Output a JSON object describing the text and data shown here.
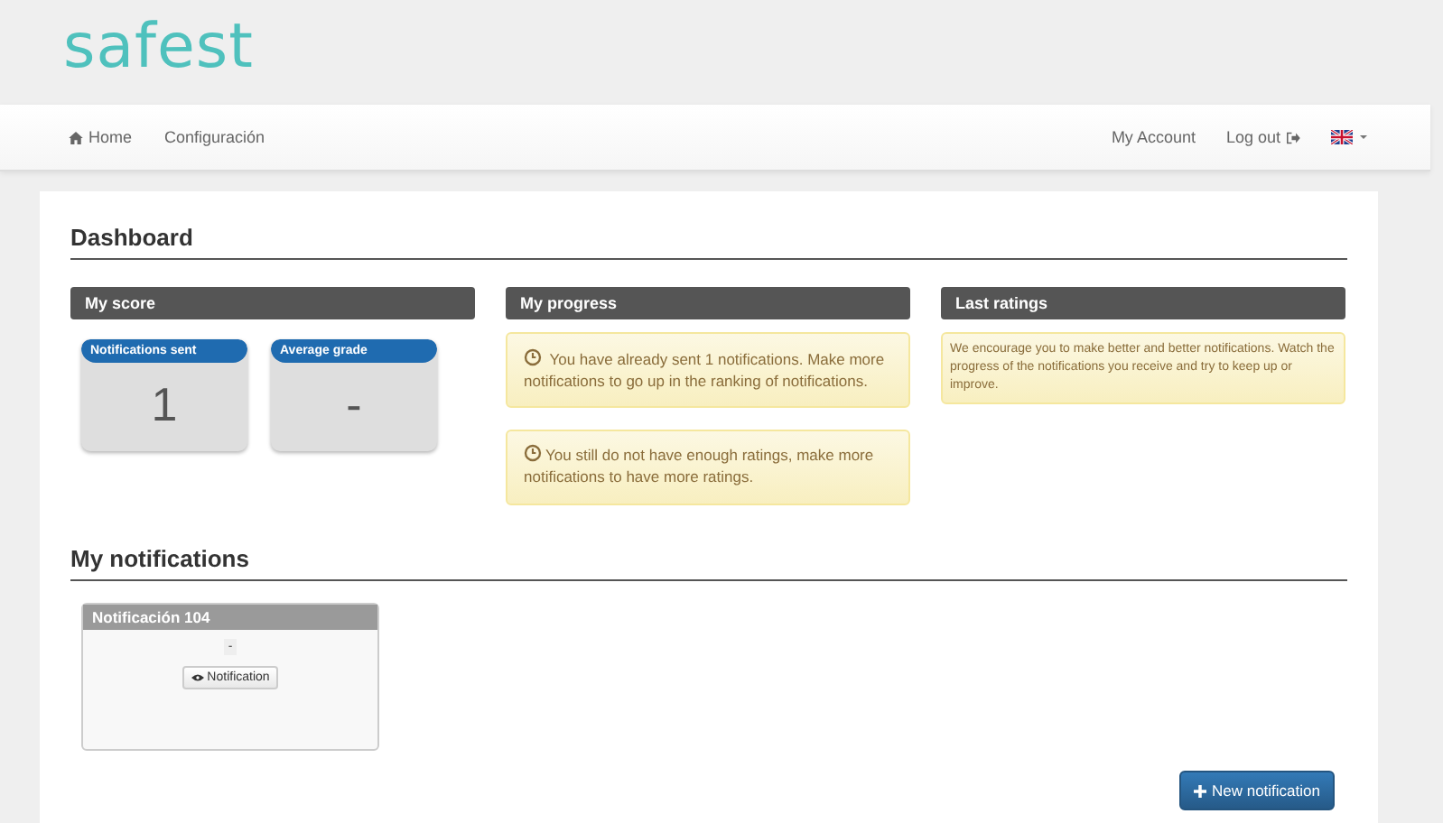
{
  "logo": "safest",
  "nav": {
    "left": [
      {
        "label": "Home"
      },
      {
        "label": "Configuración"
      }
    ],
    "right": [
      {
        "label": "My Account"
      },
      {
        "label": "Log out"
      }
    ]
  },
  "dashboard": {
    "title": "Dashboard",
    "score": {
      "title": "My score",
      "cards": [
        {
          "label": "Notifications sent",
          "value": "1"
        },
        {
          "label": "Average grade",
          "value": "-"
        }
      ]
    },
    "progress": {
      "title": "My progress",
      "alerts": [
        "You have already sent 1 notifications. Make more notifications to go up in the ranking of notifications.",
        "You still do not have enough ratings, make more notifications to have more ratings."
      ]
    },
    "ratings": {
      "title": "Last ratings",
      "text": "We encourage you to make better and better notifications. Watch the progress of the notifications you receive and try to keep up or improve."
    }
  },
  "notifications": {
    "title": "My notifications",
    "items": [
      {
        "title": "Notificación 104",
        "grade": "-",
        "button": "Notification"
      }
    ],
    "new_button": "New notification"
  }
}
